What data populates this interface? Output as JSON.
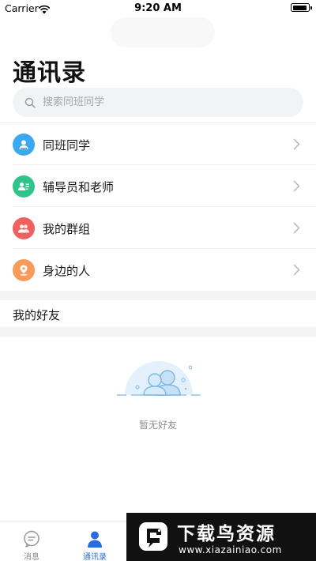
{
  "status_bar": {
    "carrier": "Carrier",
    "time": "9:20 AM"
  },
  "header": {
    "title": "通讯录"
  },
  "search": {
    "placeholder": "搜索同班同学"
  },
  "contacts": {
    "items": [
      {
        "label": "同班同学",
        "icon": "classmates-icon",
        "color": "#3aa8f2"
      },
      {
        "label": "辅导员和老师",
        "icon": "teacher-icon",
        "color": "#2ec48a"
      },
      {
        "label": "我的群组",
        "icon": "group-icon",
        "color": "#f0605f"
      },
      {
        "label": "身边的人",
        "icon": "nearby-icon",
        "color": "#f79a5a"
      }
    ]
  },
  "friends": {
    "title": "我的好友",
    "empty_text": "暂无好友"
  },
  "tabbar": {
    "tabs": [
      {
        "label": "消息",
        "icon": "message-icon",
        "active": false
      },
      {
        "label": "通讯录",
        "icon": "contacts-icon",
        "active": true
      }
    ]
  },
  "watermark": {
    "text": "下载鸟资源",
    "url": "www.xiazainiao.com"
  },
  "colors": {
    "accent": "#2c6be0",
    "divider": "#f0f0f0",
    "section_bg": "#f4f4f6"
  }
}
